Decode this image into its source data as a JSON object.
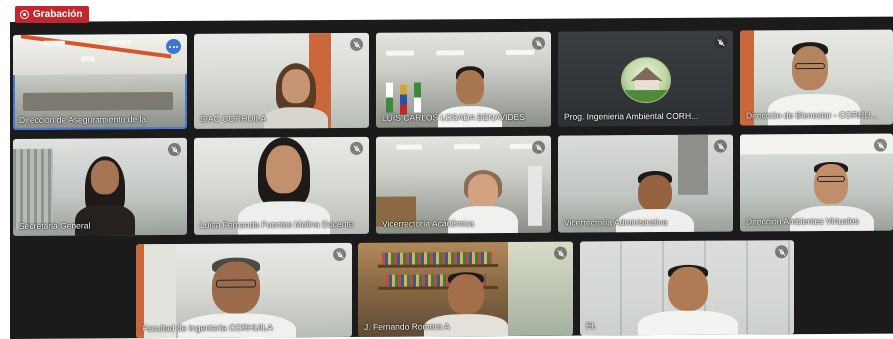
{
  "recording": {
    "label": "Grabación",
    "icon": "record-icon",
    "color": "#c4262e"
  },
  "accent_color": "#3f74d6",
  "tiles": [
    {
      "name": "Dirección de Aseguramiento de la",
      "muted": false,
      "more": true,
      "active": true
    },
    {
      "name": "SIAC CORHUILA",
      "muted": true
    },
    {
      "name": "LUIS CARLOS LOSADA BENAVIDES",
      "muted": true
    },
    {
      "name": "Prog. Ingenieria Ambiental CORH...",
      "muted": true,
      "avatar": true
    },
    {
      "name": "Dirección de Bienestar - CORHU...",
      "muted": false
    },
    {
      "name": "Secretaria General",
      "muted": true
    },
    {
      "name": "Luisa Fernanda Fuentes Molina Docente",
      "muted": true
    },
    {
      "name": "Vicerrectoría Académica",
      "muted": true
    },
    {
      "name": "Vicerrectoría Administrativa",
      "muted": true
    },
    {
      "name": "Dirección Ambientes Virtuales",
      "muted": true
    },
    {
      "name": "Facultad de Ingeniería CORHUILA",
      "muted": true
    },
    {
      "name": "J. Fernando Romero A",
      "muted": true
    },
    {
      "name": "EL",
      "muted": true
    }
  ]
}
